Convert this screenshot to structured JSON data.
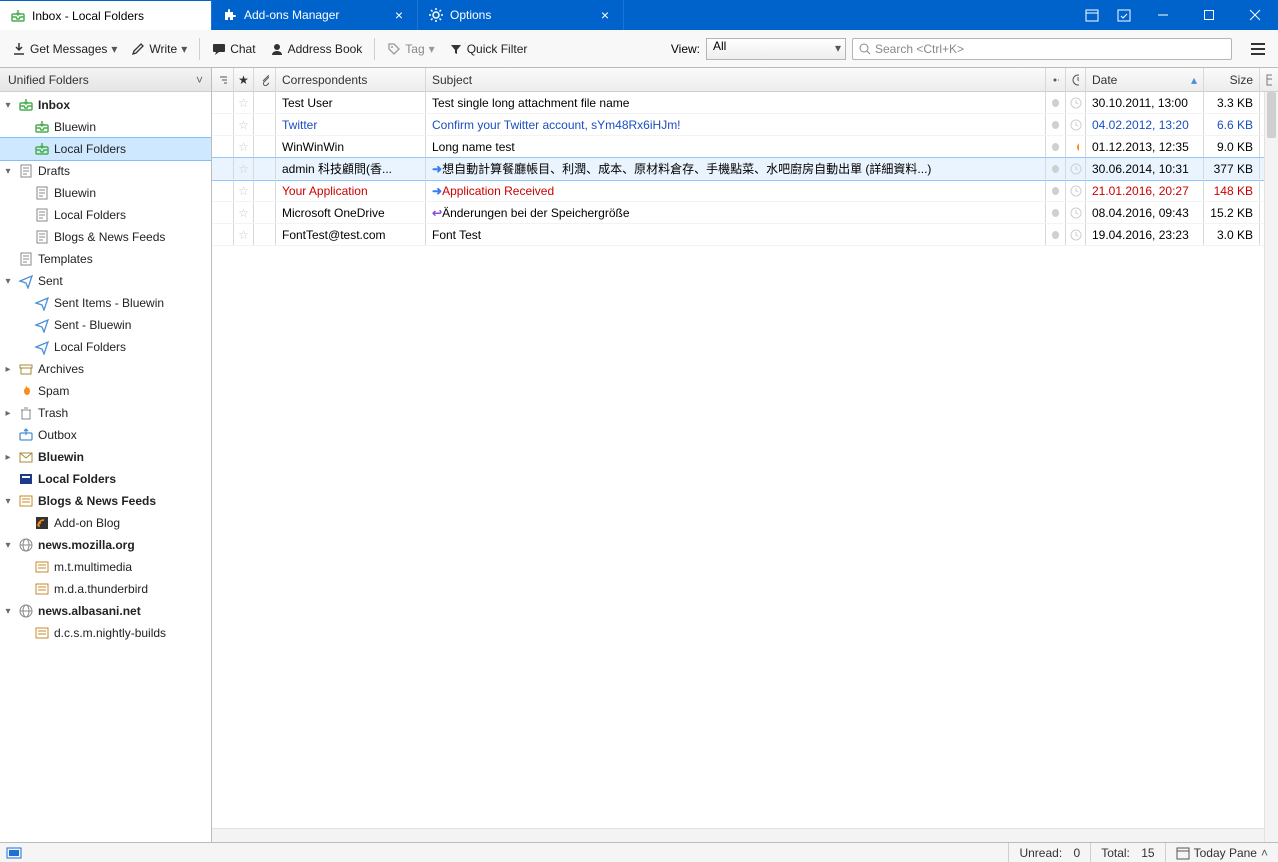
{
  "tabs": [
    {
      "label": "Inbox - Local Folders",
      "icon": "inbox"
    },
    {
      "label": "Add-ons Manager",
      "icon": "puzzle",
      "closable": true
    },
    {
      "label": "Options",
      "icon": "gear",
      "closable": true
    }
  ],
  "toolbar": {
    "get_messages": "Get Messages",
    "write": "Write",
    "chat": "Chat",
    "address_book": "Address Book",
    "tag": "Tag",
    "quick_filter": "Quick Filter",
    "view_label": "View:",
    "view_value": "All",
    "search_placeholder": "Search <Ctrl+K>"
  },
  "sidebar": {
    "header": "Unified Folders",
    "items": [
      {
        "ind": 0,
        "tw": "v",
        "icon": "inbox",
        "label": "Inbox",
        "bold": true,
        "name": "inbox"
      },
      {
        "ind": 1,
        "tw": "",
        "icon": "inbox",
        "label": "Bluewin",
        "bold": false,
        "name": "inbox-bluewin"
      },
      {
        "ind": 1,
        "tw": "",
        "icon": "inbox",
        "label": "Local Folders",
        "bold": false,
        "name": "inbox-local",
        "selected": true
      },
      {
        "ind": 0,
        "tw": "v",
        "icon": "draft",
        "label": "Drafts",
        "bold": false,
        "name": "drafts"
      },
      {
        "ind": 1,
        "tw": "",
        "icon": "draft",
        "label": "Bluewin",
        "bold": false,
        "name": "drafts-bluewin"
      },
      {
        "ind": 1,
        "tw": "",
        "icon": "draft",
        "label": "Local Folders",
        "bold": false,
        "name": "drafts-local"
      },
      {
        "ind": 1,
        "tw": "",
        "icon": "draft",
        "label": "Blogs & News Feeds",
        "bold": false,
        "name": "drafts-blogs"
      },
      {
        "ind": 0,
        "tw": "",
        "icon": "draft",
        "label": "Templates",
        "bold": false,
        "name": "templates"
      },
      {
        "ind": 0,
        "tw": "v",
        "icon": "sent",
        "label": "Sent",
        "bold": false,
        "name": "sent"
      },
      {
        "ind": 1,
        "tw": "",
        "icon": "sent",
        "label": "Sent Items - Bluewin",
        "bold": false,
        "name": "sent-items-bw"
      },
      {
        "ind": 1,
        "tw": "",
        "icon": "sent",
        "label": "Sent - Bluewin",
        "bold": false,
        "name": "sent-bw"
      },
      {
        "ind": 1,
        "tw": "",
        "icon": "sent",
        "label": "Local Folders",
        "bold": false,
        "name": "sent-local"
      },
      {
        "ind": 0,
        "tw": ">",
        "icon": "archive",
        "label": "Archives",
        "bold": false,
        "name": "archives"
      },
      {
        "ind": 0,
        "tw": "",
        "icon": "fire",
        "label": "Spam",
        "bold": false,
        "name": "spam"
      },
      {
        "ind": 0,
        "tw": ">",
        "icon": "trash",
        "label": "Trash",
        "bold": false,
        "name": "trash"
      },
      {
        "ind": 0,
        "tw": "",
        "icon": "outbox",
        "label": "Outbox",
        "bold": false,
        "name": "outbox"
      },
      {
        "ind": 0,
        "tw": ">",
        "icon": "mail",
        "label": "Bluewin",
        "bold": true,
        "name": "acct-bluewin"
      },
      {
        "ind": 0,
        "tw": "",
        "icon": "local",
        "label": "Local Folders",
        "bold": true,
        "name": "acct-local"
      },
      {
        "ind": 0,
        "tw": "v",
        "icon": "news",
        "label": "Blogs & News Feeds",
        "bold": true,
        "name": "acct-blogs"
      },
      {
        "ind": 1,
        "tw": "",
        "icon": "feed",
        "label": "Add-on Blog",
        "bold": false,
        "name": "feed-addon"
      },
      {
        "ind": 0,
        "tw": "v",
        "icon": "globe",
        "label": "news.mozilla.org",
        "bold": true,
        "name": "news-mozilla"
      },
      {
        "ind": 1,
        "tw": "",
        "icon": "news",
        "label": "m.t.multimedia",
        "bold": false,
        "name": "ng-mtmm"
      },
      {
        "ind": 1,
        "tw": "",
        "icon": "news",
        "label": "m.d.a.thunderbird",
        "bold": false,
        "name": "ng-mdatb"
      },
      {
        "ind": 0,
        "tw": "v",
        "icon": "globe",
        "label": "news.albasani.net",
        "bold": true,
        "name": "news-albasani"
      },
      {
        "ind": 1,
        "tw": "",
        "icon": "news",
        "label": "d.c.s.m.nightly-builds",
        "bold": false,
        "name": "ng-dcsm"
      }
    ]
  },
  "columns": {
    "correspondents": "Correspondents",
    "subject": "Subject",
    "date": "Date",
    "size": "Size"
  },
  "messages": [
    {
      "from": "Test User",
      "subj": "Test single long attachment file name",
      "date": "30.10.2011, 13:00",
      "size": "3.3 KB",
      "style": "",
      "arrow": "",
      "fire": false
    },
    {
      "from": "Twitter",
      "subj": "Confirm your Twitter account, sYm48Rx6iHJm!",
      "date": "04.02.2012, 13:20",
      "size": "6.6 KB",
      "style": "link",
      "arrow": "",
      "fire": false
    },
    {
      "from": "WinWinWin",
      "subj": "Long name test",
      "date": "01.12.2013, 12:35",
      "size": "9.0 KB",
      "style": "",
      "arrow": "",
      "fire": true
    },
    {
      "from": "admin 科技顧問(香...",
      "subj": "想自動計算餐廳帳目、利潤、成本、原材料倉存、手機點菜、水吧廚房自動出單 (詳細資料...)",
      "date": "30.06.2014, 10:31",
      "size": "377 KB",
      "style": "sel",
      "arrow": "fwd",
      "fire": false
    },
    {
      "from": "Your Application",
      "subj": "Application Received",
      "date": "21.01.2016, 20:27",
      "size": "148 KB",
      "style": "red",
      "arrow": "fwd",
      "fire": false
    },
    {
      "from": "Microsoft OneDrive",
      "subj": "Änderungen bei der Speichergröße",
      "date": "08.04.2016, 09:43",
      "size": "15.2 KB",
      "style": "",
      "arrow": "reply",
      "fire": false
    },
    {
      "from": "FontTest@test.com",
      "subj": "Font Test",
      "date": "19.04.2016, 23:23",
      "size": "3.0 KB",
      "style": "",
      "arrow": "",
      "fire": false
    }
  ],
  "status": {
    "unread_label": "Unread:",
    "unread_value": "0",
    "total_label": "Total:",
    "total_value": "15",
    "today_pane": "Today Pane"
  }
}
